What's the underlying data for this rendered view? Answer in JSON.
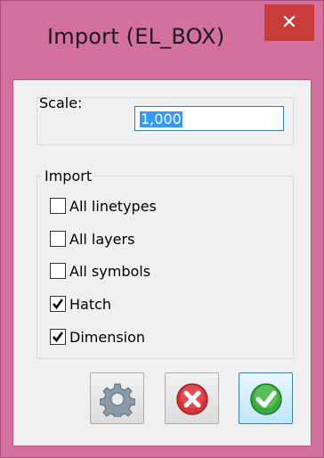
{
  "window": {
    "title": "Import (EL_BOX)",
    "close_glyph": "✕",
    "accent_color": "#d4709e",
    "close_color": "#c83c3c"
  },
  "scale": {
    "label": "Scale:",
    "value": "1,000"
  },
  "import_group": {
    "title": "Import",
    "options": [
      {
        "label": "All linetypes",
        "checked": false
      },
      {
        "label": "All layers",
        "checked": false
      },
      {
        "label": "All symbols",
        "checked": false
      },
      {
        "label": "Hatch",
        "checked": true
      },
      {
        "label": "Dimension",
        "checked": true
      }
    ]
  },
  "buttons": {
    "settings_icon": "gear-icon",
    "cancel_icon": "cancel-icon",
    "ok_icon": "check-icon"
  }
}
